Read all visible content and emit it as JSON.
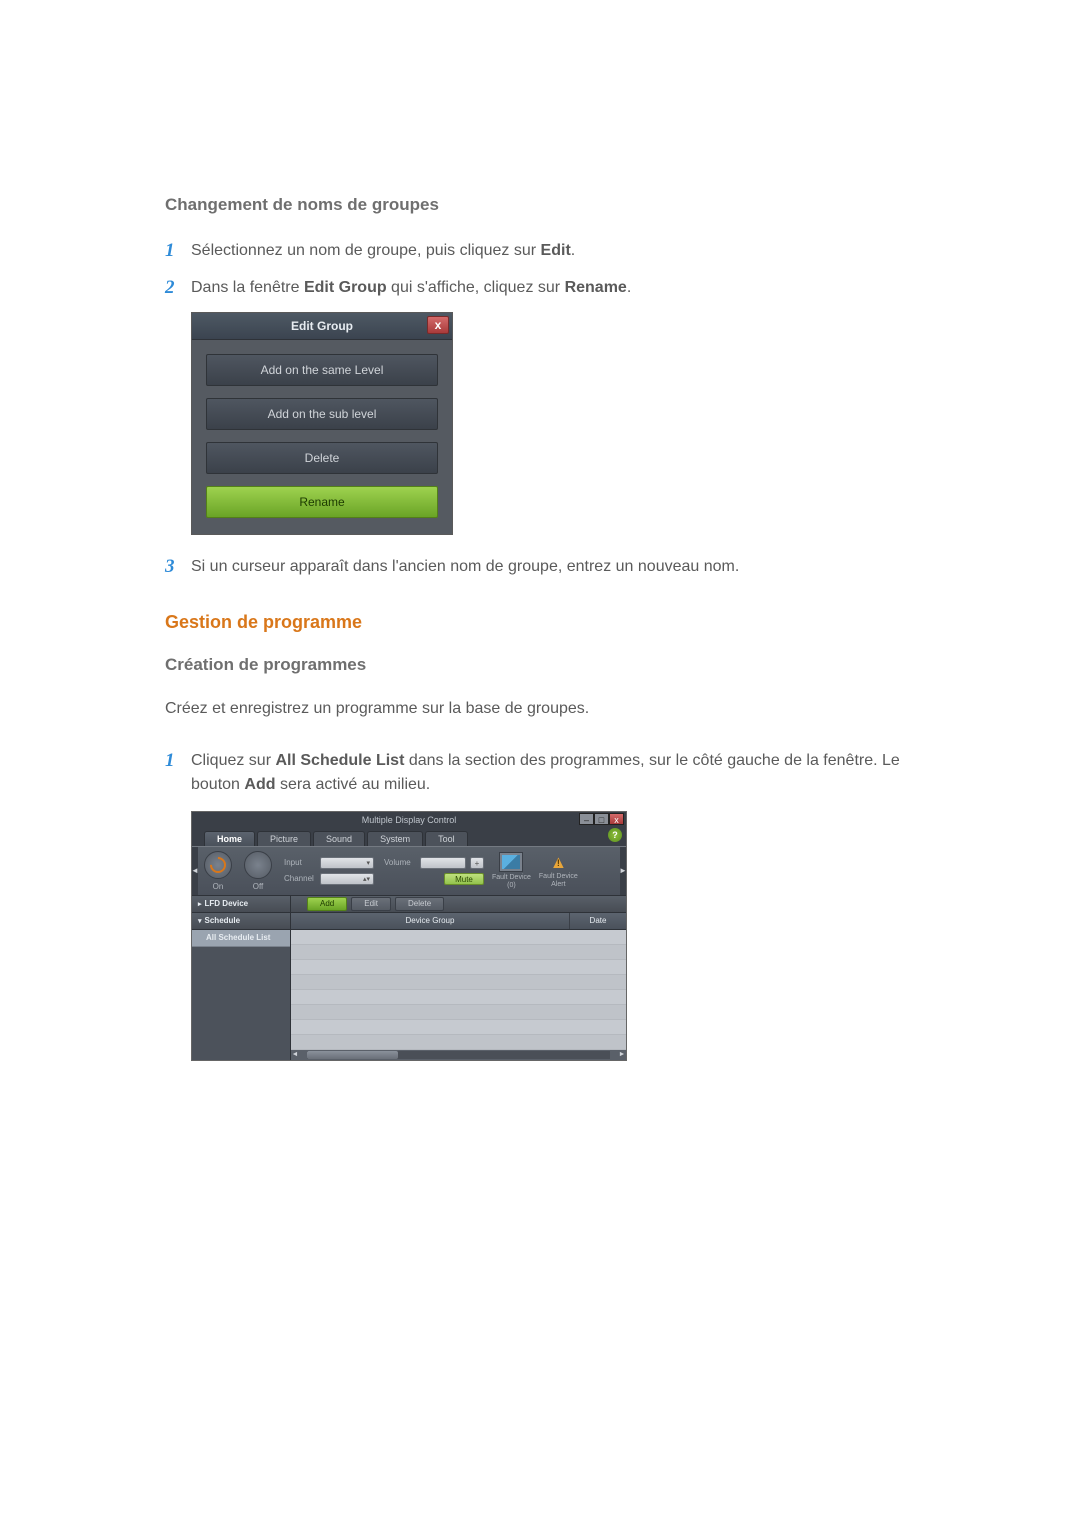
{
  "headings": {
    "rename_groups": "Changement de noms de groupes",
    "program_management": "Gestion de programme",
    "create_programs": "Création de programmes"
  },
  "steps_rename": {
    "s1_num": "1",
    "s1_a": "Sélectionnez un nom de groupe, puis cliquez sur ",
    "s1_b": "Edit",
    "s1_c": ".",
    "s2_num": "2",
    "s2_a": "Dans la fenêtre ",
    "s2_b": "Edit Group",
    "s2_c": " qui s'affiche, cliquez sur ",
    "s2_d": "Rename",
    "s2_e": ".",
    "s3_num": "3",
    "s3_a": "Si un curseur apparaît dans l'ancien nom de groupe, entrez un nouveau nom."
  },
  "dialog": {
    "title": "Edit Group",
    "close": "x",
    "add_same": "Add on the same Level",
    "add_sub": "Add on the sub level",
    "delete": "Delete",
    "rename": "Rename"
  },
  "program_intro": "Créez et enregistrez un programme sur la base de groupes.",
  "steps_program": {
    "s1_num": "1",
    "s1_a": "Cliquez sur ",
    "s1_b": "All Schedule List",
    "s1_c": " dans la section des programmes, sur le côté gauche de la fenêtre. Le bouton ",
    "s1_d": "Add",
    "s1_e": " sera activé au milieu."
  },
  "mdc": {
    "title": "Multiple Display Control",
    "win_min": "–",
    "win_max": "□",
    "win_close": "x",
    "tabs": {
      "home": "Home",
      "picture": "Picture",
      "sound": "Sound",
      "system": "System",
      "tool": "Tool"
    },
    "help": "?",
    "toolbar": {
      "on": "On",
      "off": "Off",
      "input_label": "Input",
      "channel_label": "Channel",
      "volume_label": "Volume",
      "mute": "Mute",
      "plus": "+",
      "fault0_a": "Fault Device",
      "fault0_b": "(0)",
      "fault_alert_a": "Fault Device",
      "fault_alert_b": "Alert",
      "scroll_left": "◄",
      "scroll_right": "►"
    },
    "side": {
      "lfd": "LFD Device",
      "lfd_arrow": "▸",
      "schedule": "Schedule",
      "schedule_arrow": "▾",
      "all_schedule": "All Schedule List"
    },
    "actions": {
      "add": "Add",
      "edit": "Edit",
      "delete": "Delete"
    },
    "columns": {
      "device_group": "Device Group",
      "date": "Date"
    },
    "hscroll_left": "◄",
    "hscroll_right": "►"
  }
}
